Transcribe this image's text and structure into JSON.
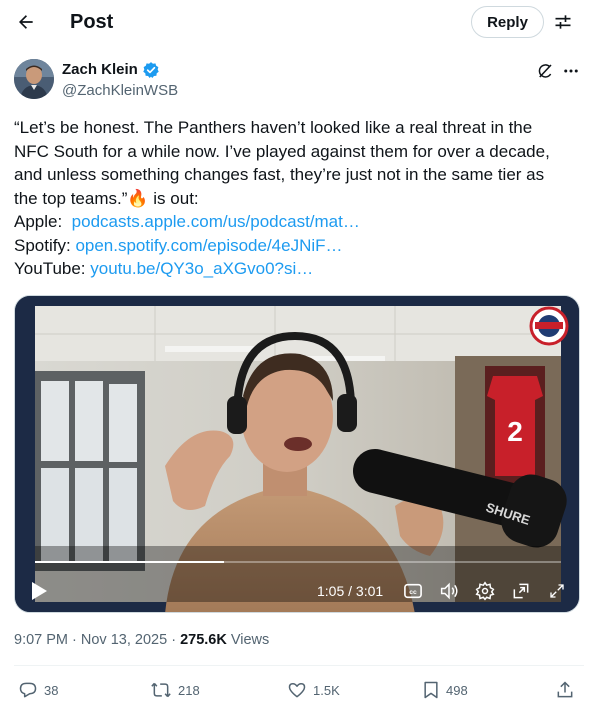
{
  "header": {
    "title": "Post",
    "reply_label": "Reply"
  },
  "author": {
    "name": "Zach Klein",
    "handle": "@ZachKleinWSB",
    "verified": true
  },
  "tweet": {
    "lines": [
      "“Let’s be honest. The Panthers haven’t looked like a real threat in the",
      "NFC South for a while now. I’ve played against them for over a decade,",
      "and unless something changes fast, they’re just not in the same tier as",
      "the top teams.”🔥 is out:"
    ],
    "links": [
      {
        "label": "Apple:",
        "url": "podcasts.apple.com/us/podcast/mat…"
      },
      {
        "label": "Spotify:",
        "url": "open.spotify.com/episode/4eJNiF…"
      },
      {
        "label": "YouTube:",
        "url": "youtu.be/QY3o_aXGvo0?si…"
      }
    ]
  },
  "video": {
    "time": "1:05 / 3:01",
    "progress": 0.36,
    "mic_brand": "SHURE",
    "jersey_number": "2",
    "accent_color": "#1d9bf0"
  },
  "meta": {
    "timestamp": "9:07 PM · Nov 13, 2025",
    "separator": "·",
    "views_count": "275.6K",
    "views_label": "Views"
  },
  "actions": {
    "replies": "38",
    "reposts": "218",
    "likes": "1.5K",
    "bookmarks": "498"
  },
  "icons": [
    "back-arrow-icon",
    "settings-sliders-icon",
    "verified-badge-icon",
    "grok-icon",
    "more-icon",
    "play-icon",
    "captions-icon",
    "volume-icon",
    "settings-gear-icon",
    "picture-in-picture-icon",
    "fullscreen-icon",
    "reply-icon",
    "repost-icon",
    "like-icon",
    "bookmark-icon",
    "share-icon"
  ]
}
